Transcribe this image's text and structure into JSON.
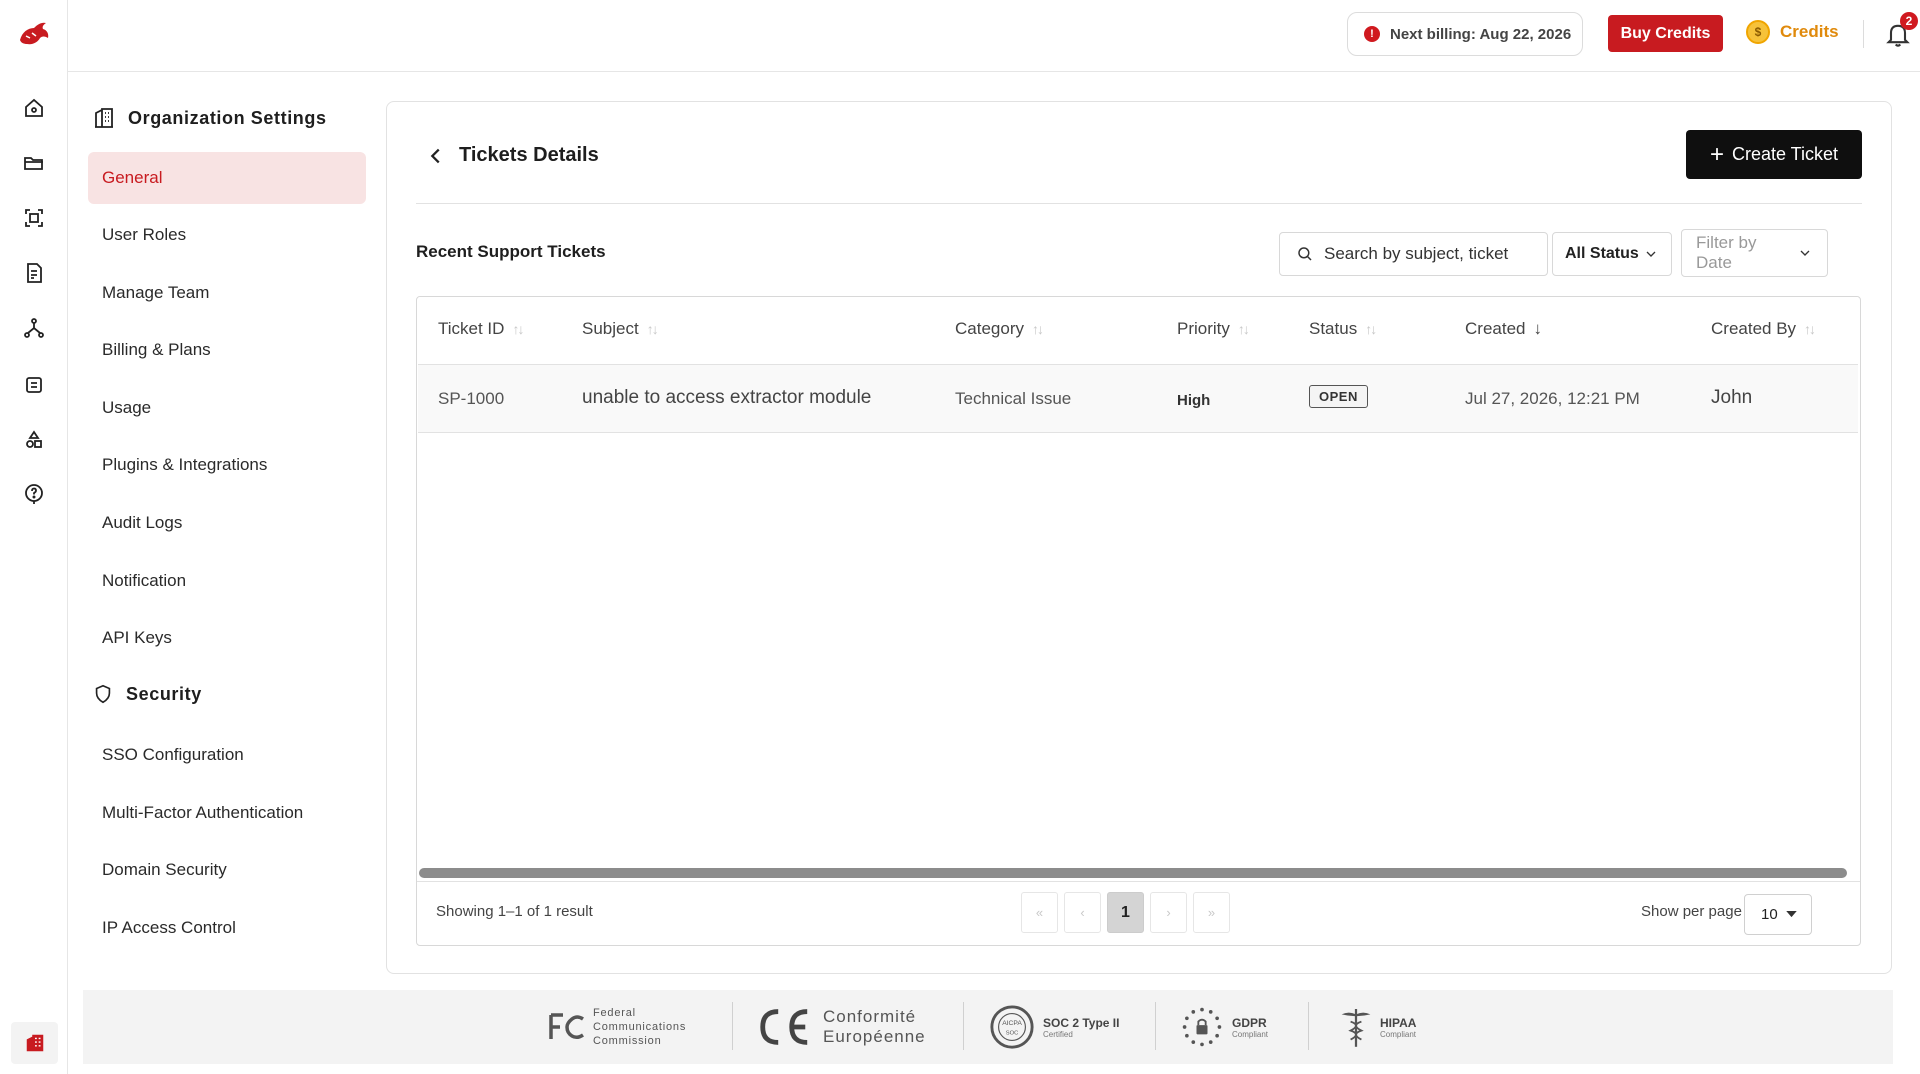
{
  "topbar": {
    "billing": "Next billing: Aug 22, 2026",
    "buy_credits": "Buy Credits",
    "credits": "Credits",
    "notification_count": "2"
  },
  "settings": {
    "org_title": "Organization Settings",
    "org_items": [
      "General",
      "User Roles",
      "Manage Team",
      "Billing & Plans",
      "Usage",
      "Plugins & Integrations",
      "Audit Logs",
      "Notification",
      "API Keys"
    ],
    "security_title": "Security",
    "security_items": [
      "SSO Configuration",
      "Multi-Factor Authentication",
      "Domain Security",
      "IP Access Control"
    ],
    "active": "General"
  },
  "main": {
    "title": "Tickets Details",
    "create_button": "Create Ticket",
    "section_title": "Recent Support Tickets",
    "search_placeholder": "Search by subject, ticket",
    "status_filter": "All Status",
    "date_filter": "Filter by Date"
  },
  "table": {
    "columns": [
      "Ticket ID",
      "Subject",
      "Category",
      "Priority",
      "Status",
      "Created",
      "Created By"
    ],
    "rows": [
      {
        "ticket_id": "SP-1000",
        "subject": "unable to access extractor module",
        "category": "Technical Issue",
        "priority": "High",
        "status": "OPEN",
        "created": "Jul 27, 2026, 12:21 PM",
        "created_by": "John"
      }
    ],
    "showing": "Showing 1–1 of 1 result",
    "current_page": "1",
    "per_page_label": "Show per page",
    "per_page": "10"
  },
  "footer": {
    "fcc": [
      "Federal",
      "Communications",
      "Commission"
    ],
    "ce": [
      "Conformité",
      "Européenne"
    ],
    "soc": {
      "title": "SOC 2 Type II",
      "sub": "Certified",
      "badge": "AICPA",
      "badge_sub": "SOC"
    },
    "gdpr": {
      "title": "GDPR",
      "sub": "Compliant"
    },
    "hipaa": {
      "title": "HIPAA",
      "sub": "Compliant"
    }
  },
  "colors": {
    "accent": "#c81b20",
    "credits": "#e08a0c",
    "active_bg": "#f8e3e3"
  }
}
